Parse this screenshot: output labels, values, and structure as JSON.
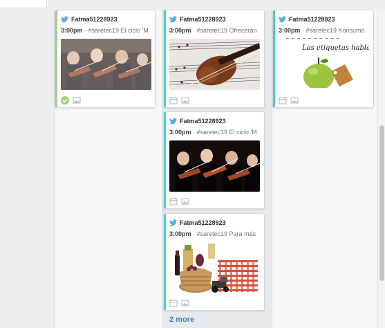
{
  "colors": {
    "twitter": "#55acee",
    "stripe_green": "#a6cf7f",
    "stripe_teal": "#4fcfcf",
    "link": "#3a83c4"
  },
  "cards": [
    {
      "user": "Fatma51228923",
      "time": "3:00pm",
      "text": "#saretec19 El ciclo 'M",
      "image": "orchestra",
      "status_icon": "check-circle-icon",
      "media_icon": "image-icon"
    },
    {
      "user": "Fatma51228923",
      "time": "3:00pm",
      "text": "#saretec19 Ofrecerán",
      "image": "violin-sheet-music",
      "status_icon": "calendar-icon",
      "media_icon": "image-icon"
    },
    {
      "user": "Fatma51228923",
      "time": "3:00pm",
      "text": "#saretec19 El ciclo 'M",
      "image": "orchestra",
      "status_icon": "calendar-icon",
      "media_icon": "image-icon"
    },
    {
      "user": "Fatma51228923",
      "time": "3:00pm",
      "text": "#saretec19 Para más",
      "image": "wine-basket-tractor",
      "status_icon": "calendar-icon",
      "media_icon": "image-icon"
    },
    {
      "user": "Fatma51228923",
      "time": "3:00pm",
      "text": "#saretec19 Konsumo",
      "image": "apple-label",
      "image_text": "Las etiquetas hablan",
      "status_icon": "calendar-icon",
      "media_icon": "image-icon"
    }
  ],
  "more_link": "2 more"
}
